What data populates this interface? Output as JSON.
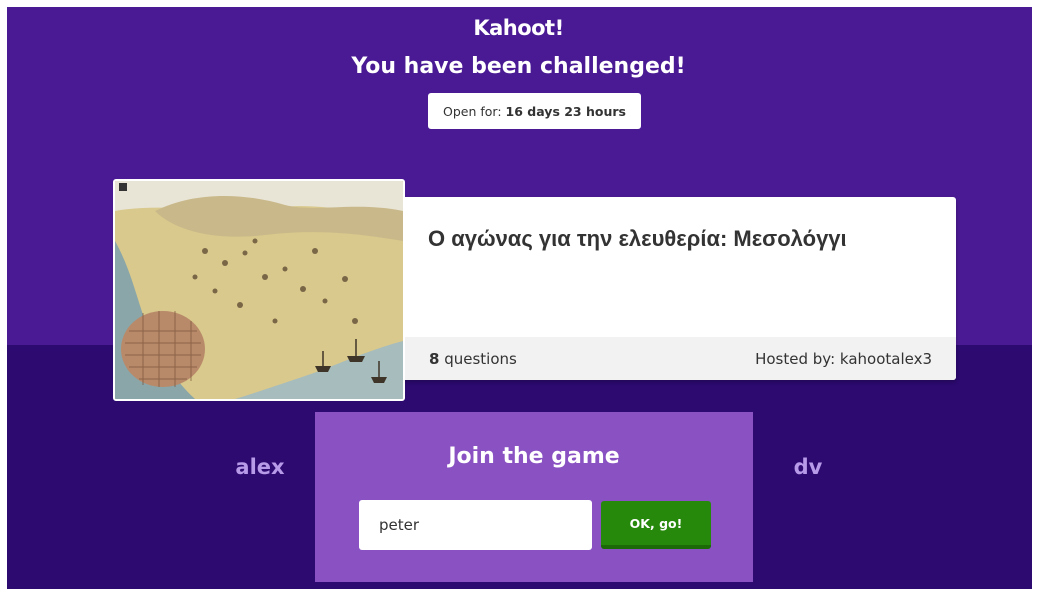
{
  "header": {
    "logo_text": "Kahoot!",
    "headline": "You have been challenged!",
    "timer_label": "Open for:",
    "timer_value": "16 days 23 hours"
  },
  "quiz": {
    "title": "Ο αγώνας για την ελευθερία: Μεσολόγγι",
    "question_count": "8",
    "question_suffix": "questions",
    "host_label": "Hosted by: kahootalex3",
    "thumbnail_icon": "image-thumbnail"
  },
  "join": {
    "title": "Join the game",
    "nickname_value": "peter",
    "button_label": "OK, go!"
  },
  "players": {
    "left": "alex",
    "right": "dv"
  },
  "colors": {
    "top_band": "#4a1a94",
    "bottom_band": "#2c0a70",
    "join_panel": "#8951c2",
    "go_button": "#26890c",
    "player_name": "#b79ae8"
  }
}
